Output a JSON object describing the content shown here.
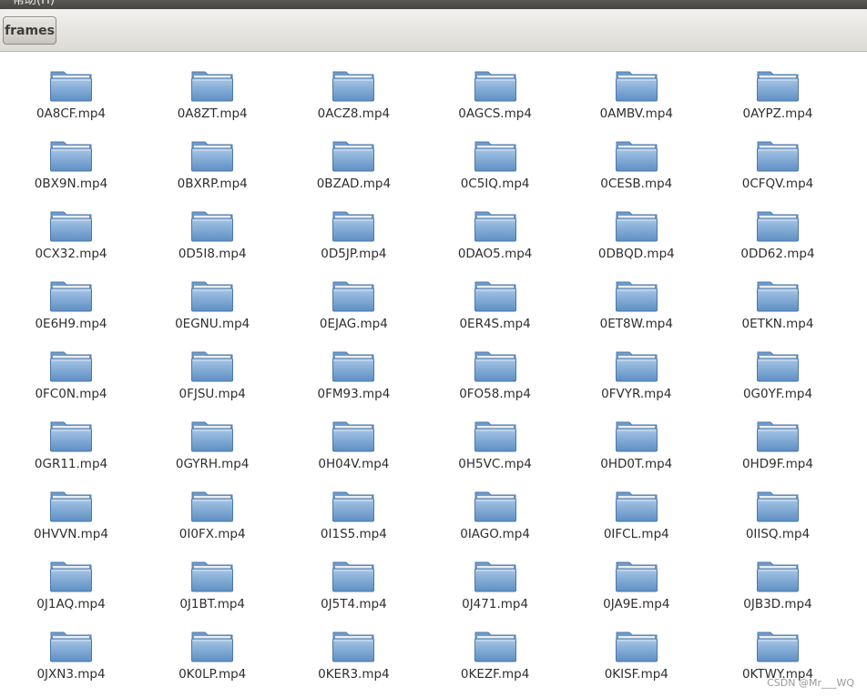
{
  "menubar": {
    "label": "帮助(H)"
  },
  "toolbar": {
    "breadcrumb": "frames"
  },
  "folder_icon": "folder-icon",
  "items": [
    "0A8CF.mp4",
    "0A8ZT.mp4",
    "0ACZ8.mp4",
    "0AGCS.mp4",
    "0AMBV.mp4",
    "0AYPZ.mp4",
    "0BX9N.mp4",
    "0BXRP.mp4",
    "0BZAD.mp4",
    "0C5IQ.mp4",
    "0CESB.mp4",
    "0CFQV.mp4",
    "0CX32.mp4",
    "0D5I8.mp4",
    "0D5JP.mp4",
    "0DAO5.mp4",
    "0DBQD.mp4",
    "0DD62.mp4",
    "0E6H9.mp4",
    "0EGNU.mp4",
    "0EJAG.mp4",
    "0ER4S.mp4",
    "0ET8W.mp4",
    "0ETKN.mp4",
    "0FC0N.mp4",
    "0FJSU.mp4",
    "0FM93.mp4",
    "0FO58.mp4",
    "0FVYR.mp4",
    "0G0YF.mp4",
    "0GR11.mp4",
    "0GYRH.mp4",
    "0H04V.mp4",
    "0H5VC.mp4",
    "0HD0T.mp4",
    "0HD9F.mp4",
    "0HVVN.mp4",
    "0I0FX.mp4",
    "0I1S5.mp4",
    "0IAGO.mp4",
    "0IFCL.mp4",
    "0IISQ.mp4",
    "0J1AQ.mp4",
    "0J1BT.mp4",
    "0J5T4.mp4",
    "0J471.mp4",
    "0JA9E.mp4",
    "0JB3D.mp4",
    "0JXN3.mp4",
    "0K0LP.mp4",
    "0KER3.mp4",
    "0KEZF.mp4",
    "0KISF.mp4",
    "0KTWY.mp4"
  ],
  "watermark": "CSDN @Mr___WQ"
}
